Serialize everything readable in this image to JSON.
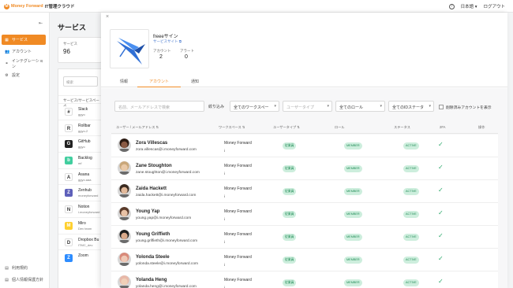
{
  "header": {
    "brand": "Money Forward",
    "product": "IT管理クラウド",
    "language": "日本語",
    "logout": "ログアウト"
  },
  "sidebar": {
    "items": [
      {
        "label": "サービス",
        "icon": "grid-icon",
        "active": true
      },
      {
        "label": "アカウント",
        "icon": "people-icon",
        "active": false
      },
      {
        "label": "インテグレーション",
        "icon": "link-icon",
        "active": false
      },
      {
        "label": "設定",
        "icon": "gear-icon",
        "active": false
      }
    ],
    "footer": [
      {
        "label": "利用規約",
        "icon": "document-icon"
      },
      {
        "label": "個人情報保護方針",
        "icon": "document-icon"
      }
    ]
  },
  "services_page": {
    "title": "サービス",
    "count_label": "サービス",
    "count": "96",
    "search_placeholder": "検索",
    "list_header": "サービス/サービスペース",
    "list": [
      {
        "name": "Slack",
        "sub": "ggyo",
        "color": "#ffffff",
        "glyph": "#"
      },
      {
        "name": "Rollbar",
        "sub": "ggyo-2",
        "color": "#ffffff",
        "glyph": "R"
      },
      {
        "name": "GitHub",
        "sub": "ggyo",
        "color": "#222222",
        "glyph": "G"
      },
      {
        "name": "Backlog",
        "sub": "mf",
        "color": "#42ce9f",
        "glyph": "b"
      },
      {
        "name": "Asana",
        "sub": "ggyo.aaa",
        "color": "#ffffff",
        "glyph": "A"
      },
      {
        "name": "Zenhub",
        "sub": "moneyforward",
        "color": "#5e60ba",
        "glyph": "Z"
      },
      {
        "name": "Notion",
        "sub": "i.moneyforward",
        "color": "#ffffff",
        "glyph": "N"
      },
      {
        "name": "Miro",
        "sub": "Dev team",
        "color": "#ffd02f",
        "glyph": "M"
      },
      {
        "name": "Dropbox Bu",
        "sub": "ITMC_dev",
        "color": "#ffffff",
        "glyph": "D"
      },
      {
        "name": "Zoom",
        "sub": "",
        "color": "#2d8cff",
        "glyph": "Z"
      }
    ]
  },
  "detail": {
    "app_name": "freeeサイン",
    "site_link": "サービスサイト ⧉",
    "accounts_label": "アカウント",
    "accounts_value": "2",
    "alerts_label": "アラート",
    "alerts_value": "0",
    "tabs": [
      {
        "label": "情報",
        "active": false
      },
      {
        "label": "アカウント",
        "active": true
      },
      {
        "label": "通知",
        "active": false
      }
    ],
    "filters": {
      "search_placeholder": "名前、メールアドレスで検索",
      "narrow_label": "絞り込み",
      "workspace": "全てのワークスペー",
      "user_type": "ユーザータイプ",
      "role": "全てのロール",
      "status": "全てのIDステータ",
      "deleted_label": "削除済みアカウントを表示"
    },
    "columns": [
      "ユーザー / メールアドレス ⇅",
      "ワークスペース ⇅",
      "ユーザータイプ ⇅",
      "ロール",
      "ステータス",
      "2FA",
      "操作"
    ],
    "rows": [
      {
        "name": "Zora Villescas",
        "email": "zora.villescas@i.moneyforward.com",
        "workspace": "Money Forward",
        "ws_line2": "i",
        "type": "従業員",
        "role": "MEMBER",
        "status": "ACTIVE",
        "twofa": "✓",
        "skin": "#8a5a44",
        "hair": "#2b1a12"
      },
      {
        "name": "Zane Stoughton",
        "email": "zane.stoughton@i.moneyforward.com",
        "workspace": "Money Forward",
        "ws_line2": "i",
        "type": "従業員",
        "role": "MEMBER",
        "status": "ACTIVE",
        "twofa": "✓",
        "skin": "#e9c9a8",
        "hair": "#c9a77a"
      },
      {
        "name": "Zaida Hackett",
        "email": "zaida.hackett@i.moneyforward.com",
        "workspace": "Money Forward",
        "ws_line2": "i",
        "type": "従業員",
        "role": "MEMBER",
        "status": "ACTIVE",
        "twofa": "✓",
        "skin": "#e2b99a",
        "hair": "#3a2a20"
      },
      {
        "name": "Young Yap",
        "email": "young.yap@i.moneyforward.com",
        "workspace": "Money Forward",
        "ws_line2": "i",
        "type": "従業員",
        "role": "MEMBER",
        "status": "ACTIVE",
        "twofa": "✓",
        "skin": "#e8c2a6",
        "hair": "#5a3a2a"
      },
      {
        "name": "Young Griffieth",
        "email": "young.griffieth@i.moneyforward.com",
        "workspace": "Money Forward",
        "ws_line2": "i",
        "type": "従業員",
        "role": "MEMBER",
        "status": "ACTIVE",
        "twofa": "✓",
        "skin": "#d9a98a",
        "hair": "#1e1e1e"
      },
      {
        "name": "Yolonda Steele",
        "email": "yolonda.steele@i.moneyforward.com",
        "workspace": "Money Forward",
        "ws_line2": "i",
        "type": "従業員",
        "role": "MEMBER",
        "status": "ACTIVE",
        "twofa": "✓",
        "skin": "#efc9b6",
        "hair": "#d98a7a"
      },
      {
        "name": "Yolanda Heng",
        "email": "yolanda.heng@i.moneyforward.com",
        "workspace": "Money Forward",
        "ws_line2": "i",
        "type": "従業員",
        "role": "MEMBER",
        "status": "ACTIVE",
        "twofa": "✓",
        "skin": "#f0d0b8",
        "hair": "#e8b8a8"
      }
    ]
  },
  "colors": {
    "accent": "#f08a24",
    "badge_bg": "#cdeedd",
    "badge_text": "#1f8b55",
    "check": "#2aa86a",
    "link": "#4a7bd0"
  }
}
